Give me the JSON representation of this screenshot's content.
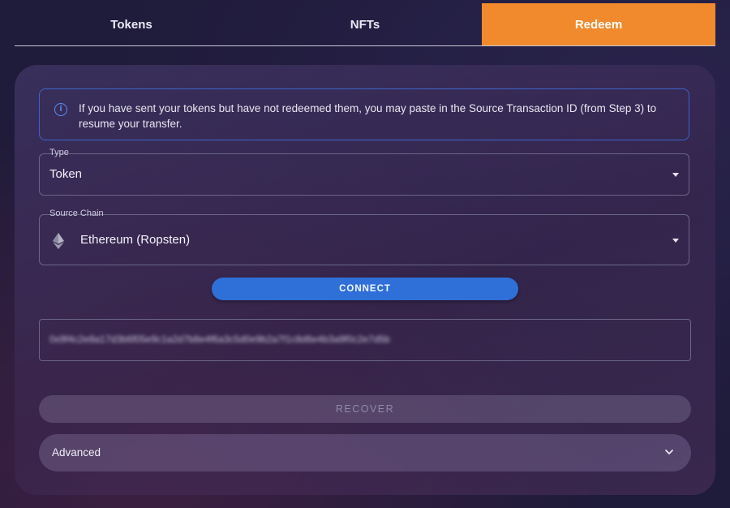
{
  "tabs": [
    {
      "label": "Tokens"
    },
    {
      "label": "NFTs"
    },
    {
      "label": "Redeem"
    }
  ],
  "info": {
    "icon": "info-icon",
    "text": "If you have sent your tokens but have not redeemed them, you may paste in the Source Transaction ID (from Step 3) to resume your transfer."
  },
  "type_field": {
    "label": "Type",
    "value": "Token"
  },
  "source_chain": {
    "label": "Source Chain",
    "value": "Ethereum (Ropsten)",
    "icon": "ethereum-icon"
  },
  "connect_label": "CONNECT",
  "transaction_id_blurred": "0x9f4c2e8a17d3b6f05e9c1a2d7b8e4f6a3c5d0e9b2a7f1c8d6e4b3a9f0c2e7d5b",
  "recover_label": "RECOVER",
  "advanced_label": "Advanced",
  "colors": {
    "accent": "#f08a2c",
    "connect": "#2f6fd8",
    "info_border": "#3d63c9"
  }
}
